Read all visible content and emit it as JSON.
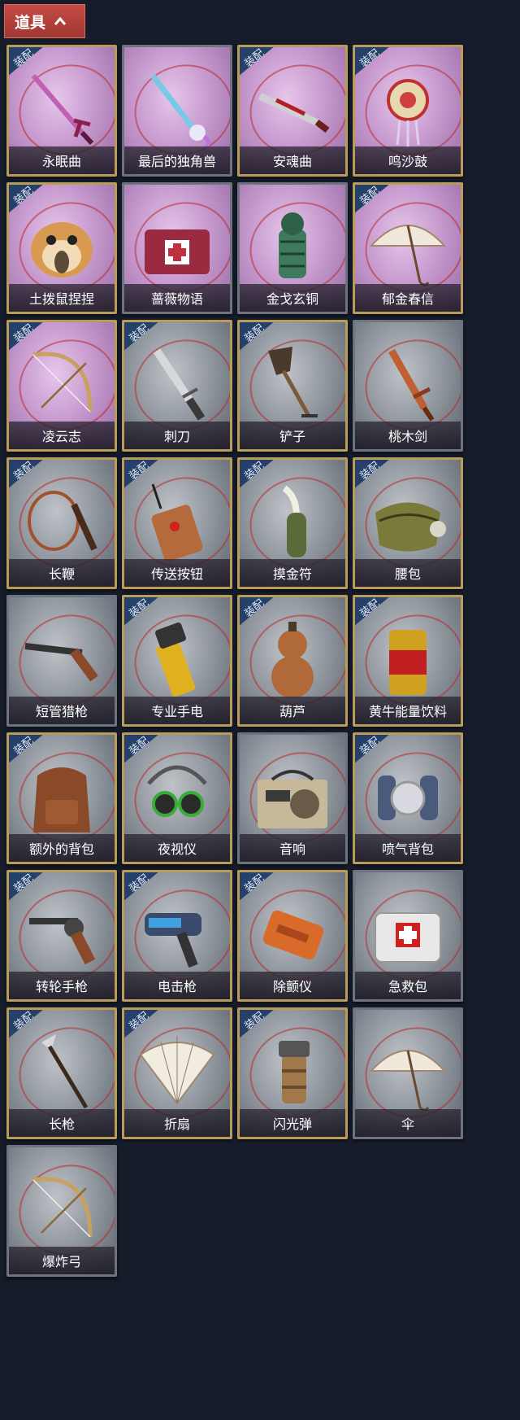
{
  "header": {
    "title": "道具",
    "chevron": "chevron-up-icon"
  },
  "equip_tag": "装配",
  "items": [
    {
      "label": "永眠曲",
      "icon": "sword-icon",
      "rarity": "purple",
      "equipped": true
    },
    {
      "label": "最后的独角兽",
      "icon": "unicorn-sword-icon",
      "rarity": "purple",
      "equipped": false
    },
    {
      "label": "安魂曲",
      "icon": "red-blade-icon",
      "rarity": "purple",
      "equipped": true
    },
    {
      "label": "鸣沙鼓",
      "icon": "drum-icon",
      "rarity": "purple",
      "equipped": true
    },
    {
      "label": "土拨鼠捏捏",
      "icon": "hamster-icon",
      "rarity": "purple",
      "equipped": true
    },
    {
      "label": "蔷薇物语",
      "icon": "medkit-icon",
      "rarity": "purple",
      "equipped": false
    },
    {
      "label": "金戈玄铜",
      "icon": "grenade-icon",
      "rarity": "purple",
      "equipped": false
    },
    {
      "label": "郁金春信",
      "icon": "umbrella-icon",
      "rarity": "purple",
      "equipped": true
    },
    {
      "label": "凌云志",
      "icon": "bow-icon",
      "rarity": "purple",
      "equipped": true
    },
    {
      "label": "刺刀",
      "icon": "knife-icon",
      "rarity": "grey",
      "equipped": true
    },
    {
      "label": "铲子",
      "icon": "shovel-icon",
      "rarity": "grey",
      "equipped": true
    },
    {
      "label": "桃木剑",
      "icon": "wooden-sword-icon",
      "rarity": "grey",
      "equipped": false
    },
    {
      "label": "长鞭",
      "icon": "whip-icon",
      "rarity": "grey",
      "equipped": true
    },
    {
      "label": "传送按钮",
      "icon": "remote-icon",
      "rarity": "grey",
      "equipped": true
    },
    {
      "label": "摸金符",
      "icon": "talisman-icon",
      "rarity": "grey",
      "equipped": true
    },
    {
      "label": "腰包",
      "icon": "waist-bag-icon",
      "rarity": "grey",
      "equipped": true
    },
    {
      "label": "短管猎枪",
      "icon": "shotgun-icon",
      "rarity": "grey",
      "equipped": false
    },
    {
      "label": "专业手电",
      "icon": "flashlight-icon",
      "rarity": "grey",
      "equipped": true
    },
    {
      "label": "葫芦",
      "icon": "gourd-icon",
      "rarity": "grey",
      "equipped": true
    },
    {
      "label": "黄牛能量饮料",
      "icon": "can-icon",
      "rarity": "grey",
      "equipped": true
    },
    {
      "label": "额外的背包",
      "icon": "backpack-icon",
      "rarity": "grey",
      "equipped": true
    },
    {
      "label": "夜视仪",
      "icon": "goggles-icon",
      "rarity": "grey",
      "equipped": true
    },
    {
      "label": "音响",
      "icon": "radio-icon",
      "rarity": "grey",
      "equipped": false
    },
    {
      "label": "喷气背包",
      "icon": "jetpack-icon",
      "rarity": "grey",
      "equipped": true
    },
    {
      "label": "转轮手枪",
      "icon": "revolver-icon",
      "rarity": "grey",
      "equipped": true
    },
    {
      "label": "电击枪",
      "icon": "taser-icon",
      "rarity": "grey",
      "equipped": true
    },
    {
      "label": "除颤仪",
      "icon": "defibrillator-icon",
      "rarity": "grey",
      "equipped": true
    },
    {
      "label": "急救包",
      "icon": "first-aid-kit-icon",
      "rarity": "grey",
      "equipped": false
    },
    {
      "label": "长枪",
      "icon": "spear-icon",
      "rarity": "grey",
      "equipped": true
    },
    {
      "label": "折扇",
      "icon": "fan-icon",
      "rarity": "grey",
      "equipped": true
    },
    {
      "label": "闪光弹",
      "icon": "flashbang-icon",
      "rarity": "grey",
      "equipped": true
    },
    {
      "label": "伞",
      "icon": "umbrella-icon",
      "rarity": "grey",
      "equipped": false
    },
    {
      "label": "爆炸弓",
      "icon": "bow-icon",
      "rarity": "grey",
      "equipped": false
    }
  ]
}
